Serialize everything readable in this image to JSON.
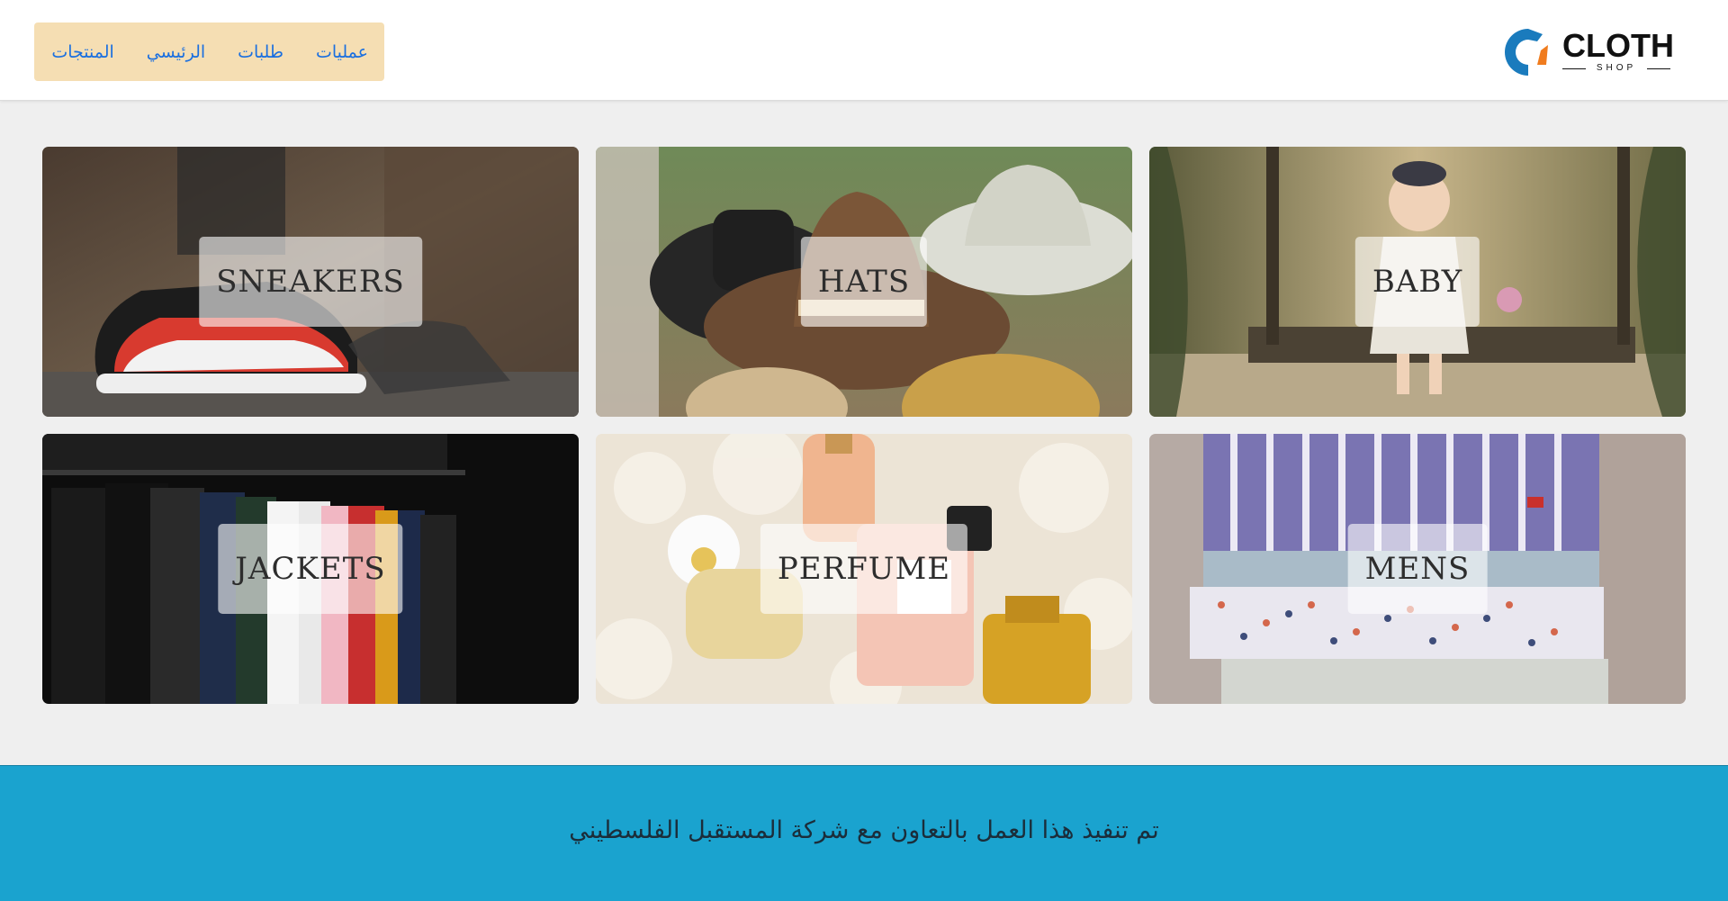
{
  "header": {
    "logo": {
      "word": "CLOTH",
      "sub": "SHOP",
      "colors": {
        "blue": "#1a7bbd",
        "orange": "#f07c1e"
      }
    },
    "nav": {
      "background": "#f5deb3",
      "items": [
        {
          "label": "عمليات"
        },
        {
          "label": "طلبات"
        },
        {
          "label": "الرئيسي"
        },
        {
          "label": "المنتجات"
        }
      ]
    }
  },
  "categories": [
    {
      "label": "SNEAKERS",
      "image": "red-sneaker-photo"
    },
    {
      "label": "HATS",
      "image": "hats-photo"
    },
    {
      "label": "BABY",
      "image": "child-on-swing-photo"
    },
    {
      "label": "JACKETS",
      "image": "clothes-rack-photo"
    },
    {
      "label": "PERFUME",
      "image": "perfume-bottles-photo"
    },
    {
      "label": "MENS",
      "image": "folded-shirts-photo"
    }
  ],
  "footer": {
    "note": "تم تنفيذ هذا العمل بالتعاون مع شركة المستقبل الفلسطيني",
    "background": "#1aa3cf"
  }
}
